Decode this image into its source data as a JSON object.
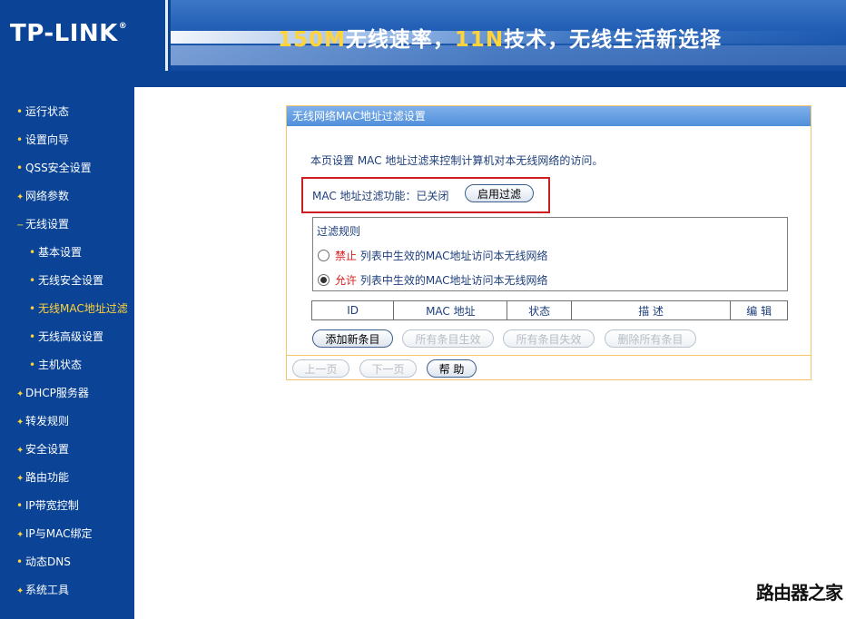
{
  "header": {
    "logo": "TP-LINK",
    "logo_mark": "®",
    "slogan": {
      "part1": "150M",
      "part2": "无线速率，",
      "part3": "11N",
      "part4": "技术，无线生活新选择"
    }
  },
  "sidebar": {
    "items": [
      {
        "label": "运行状态"
      },
      {
        "label": "设置向导"
      },
      {
        "label": "QSS安全设置"
      },
      {
        "label": "网络参数"
      },
      {
        "label": "无线设置"
      },
      {
        "label": "基本设置"
      },
      {
        "label": "无线安全设置"
      },
      {
        "label": "无线MAC地址过滤"
      },
      {
        "label": "无线高级设置"
      },
      {
        "label": "主机状态"
      },
      {
        "label": "DHCP服务器"
      },
      {
        "label": "转发规则"
      },
      {
        "label": "安全设置"
      },
      {
        "label": "路由功能"
      },
      {
        "label": "IP带宽控制"
      },
      {
        "label": "IP与MAC绑定"
      },
      {
        "label": "动态DNS"
      },
      {
        "label": "系统工具"
      }
    ],
    "bullet_plus": "✦",
    "bullet_dot": "•",
    "bullet_minus": "−"
  },
  "panel": {
    "title": "无线网络MAC地址过滤设置",
    "description": "本页设置 MAC 地址过滤来控制计算机对本无线网络的访问。",
    "status_label": "MAC 地址过滤功能：已关闭",
    "enable_button": "启用过滤",
    "rules": {
      "title": "过滤规则",
      "deny_keyword": "禁止",
      "deny_text": " 列表中生效的MAC地址访问本无线网络",
      "allow_keyword": "允许",
      "allow_text": " 列表中生效的MAC地址访问本无线网络",
      "selected": "allow"
    },
    "table": {
      "columns": [
        "ID",
        "MAC 地址",
        "状态",
        "描 述",
        "编 辑"
      ]
    },
    "buttons": {
      "add": "添加新条目",
      "enable_all": "所有条目生效",
      "disable_all": "所有条目失效",
      "delete_all": "删除所有条目",
      "prev": "上一页",
      "next": "下一页",
      "help": "帮 助"
    }
  },
  "watermark": "路由器之家",
  "colors": {
    "brand_blue": "#0b4496",
    "accent_yellow": "#ffd33a",
    "panel_border": "#f5c56d",
    "highlight_red": "#cc1f1f"
  }
}
